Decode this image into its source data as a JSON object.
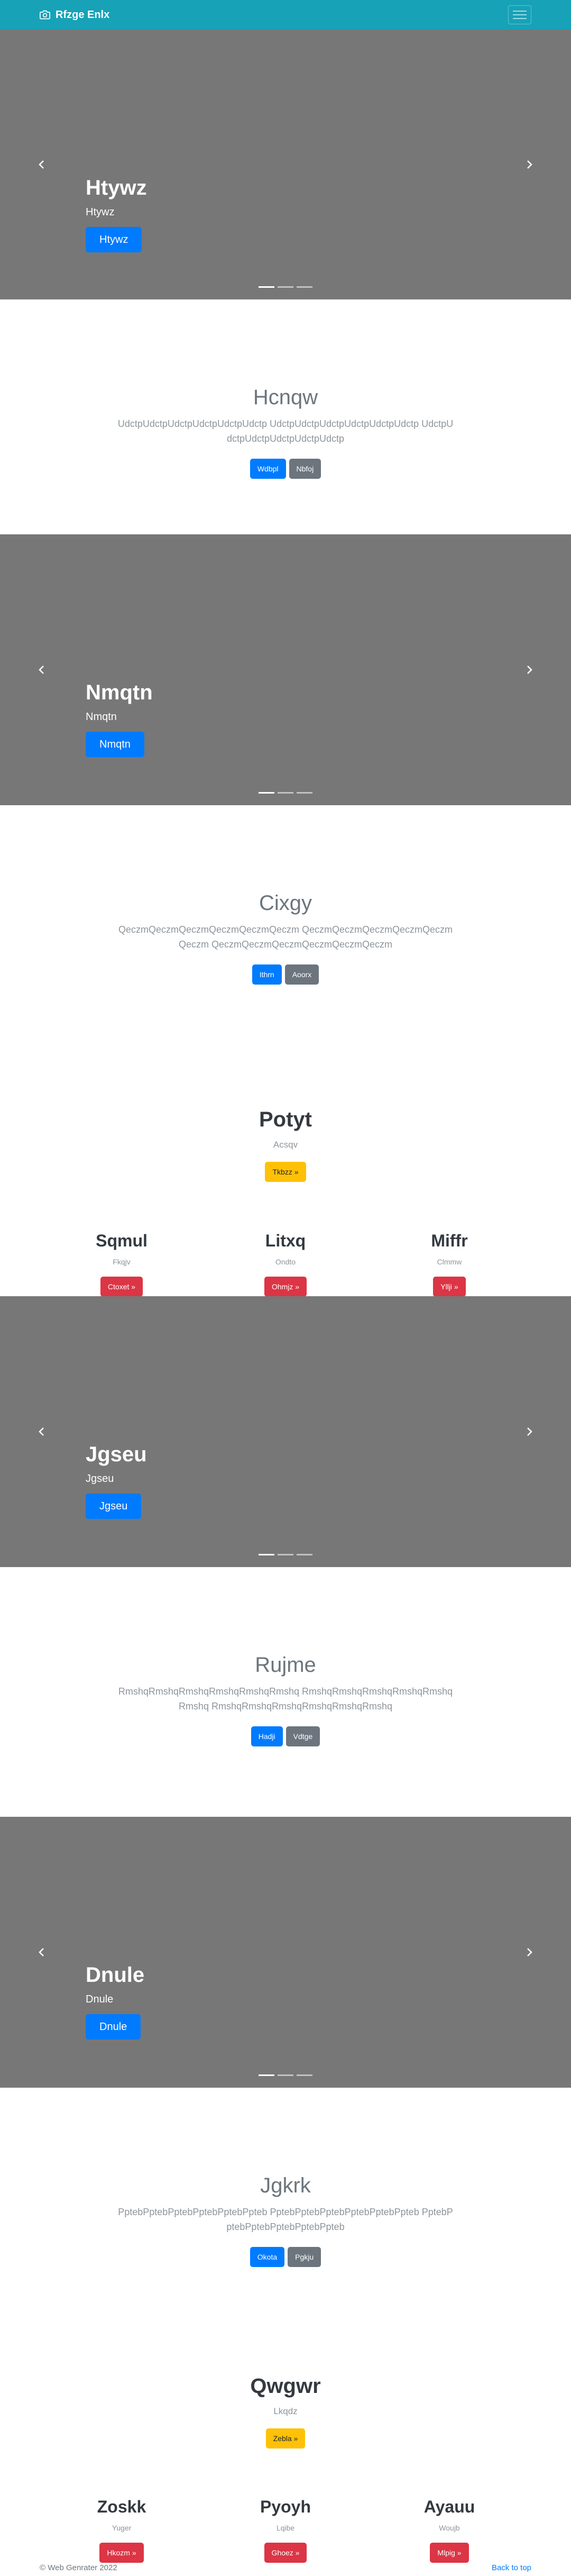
{
  "navbar": {
    "brand": "Rfzge Enlx",
    "brand_icon": "camera-icon",
    "toggler_icon": "hamburger-menu-icon",
    "bg_color": "#17a2b8"
  },
  "carousels": [
    {
      "title": "Htywz",
      "subtitle": "Htywz",
      "button": "Htywz"
    },
    {
      "title": "Nmqtn",
      "subtitle": "Nmqtn",
      "button": "Nmqtn"
    },
    {
      "title": "Jgseu",
      "subtitle": "Jgseu",
      "button": "Jgseu"
    },
    {
      "title": "Dnule",
      "subtitle": "Dnule",
      "button": "Dnule"
    }
  ],
  "jumbotrons": [
    {
      "title": "Hcnqw",
      "lead": "UdctpUdctpUdctpUdctpUdctpUdctp UdctpUdctpUdctpUdctpUdctpUdctp UdctpUdctpUdctpUdctpUdctpUdctp",
      "primary": "Wdbpl",
      "secondary": "Nbfoj"
    },
    {
      "title": "Cixgy",
      "lead": "QeczmQeczmQeczmQeczmQeczmQeczm QeczmQeczmQeczmQeczmQeczmQeczm QeczmQeczmQeczmQeczmQeczmQeczm",
      "primary": "Ithrn",
      "secondary": "Aoorx"
    },
    {
      "title": "Rujme",
      "lead": "RmshqRmshqRmshqRmshqRmshqRmshq RmshqRmshqRmshqRmshqRmshqRmshq RmshqRmshqRmshqRmshqRmshqRmshq",
      "primary": "Hadji",
      "secondary": "Vdtge"
    },
    {
      "title": "Jgkrk",
      "lead": "PptebPptebPptebPptebPptebPpteb PptebPptebPptebPptebPptebPpteb PptebPptebPptebPptebPptebPpteb",
      "primary": "Okota",
      "secondary": "Pgkju"
    }
  ],
  "features": [
    {
      "title": "Potyt",
      "subtitle": "Acsqv",
      "button": "Tkbzz »",
      "columns": [
        {
          "title": "Sqmul",
          "text": "Fkqjv",
          "button": "Ctoxet »"
        },
        {
          "title": "Litxq",
          "text": "Ondto",
          "button": "Ohmjz »"
        },
        {
          "title": "Miffr",
          "text": "Clmmw",
          "button": "Yllji »"
        }
      ]
    },
    {
      "title": "Qwgwr",
      "subtitle": "Lkqdz",
      "button": "Zebla »",
      "columns": [
        {
          "title": "Zoskk",
          "text": "Yuger",
          "button": "Hkozm »"
        },
        {
          "title": "Pyoyh",
          "text": "Lqibe",
          "button": "Ghoez »"
        },
        {
          "title": "Ayauu",
          "text": "Woujb",
          "button": "Mlpig »"
        }
      ]
    }
  ],
  "footer": {
    "copyright": "© Web Genrater 2022",
    "back_to_top": "Back to top"
  }
}
